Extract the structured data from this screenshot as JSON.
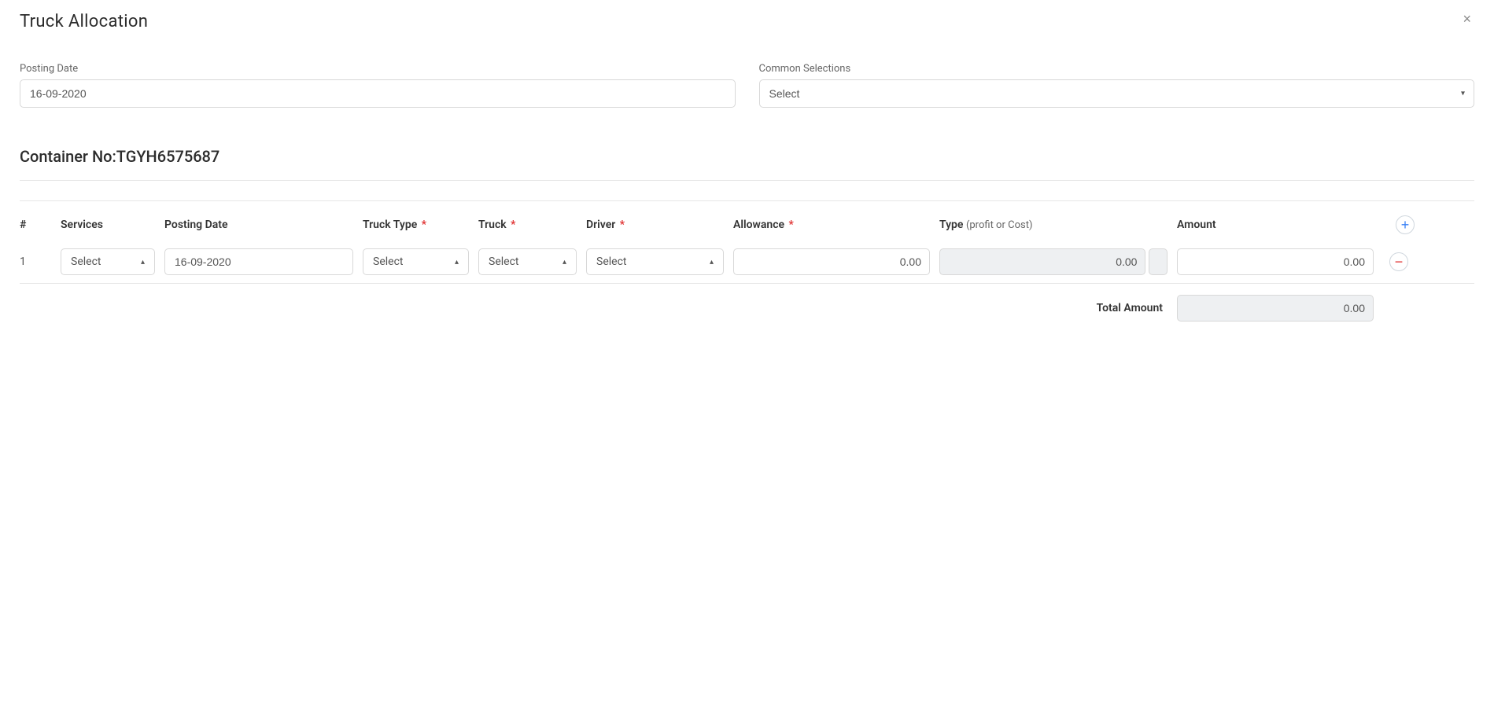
{
  "header": {
    "title": "Truck Allocation"
  },
  "form": {
    "postingDateLabel": "Posting Date",
    "postingDateValue": "16-09-2020",
    "commonSelectionsLabel": "Common Selections",
    "commonSelectionsValue": "Select"
  },
  "container": {
    "prefix": "Container No:",
    "number": "TGYH6575687"
  },
  "table": {
    "headers": {
      "idx": "#",
      "services": "Services",
      "postingDate": "Posting Date",
      "truckType": "Truck Type",
      "truck": "Truck",
      "driver": "Driver",
      "allowance": "Allowance",
      "type": "Type",
      "typeNote": "(profit or Cost)",
      "amount": "Amount"
    },
    "selectPlaceholder": "Select",
    "rows": [
      {
        "idx": "1",
        "services": "Select",
        "postingDate": "16-09-2020",
        "truckType": "Select",
        "truck": "Select",
        "driver": "Select",
        "allowance": "0.00",
        "type": "0.00",
        "amount": "0.00"
      }
    ],
    "totalLabel": "Total Amount",
    "totalValue": "0.00"
  }
}
